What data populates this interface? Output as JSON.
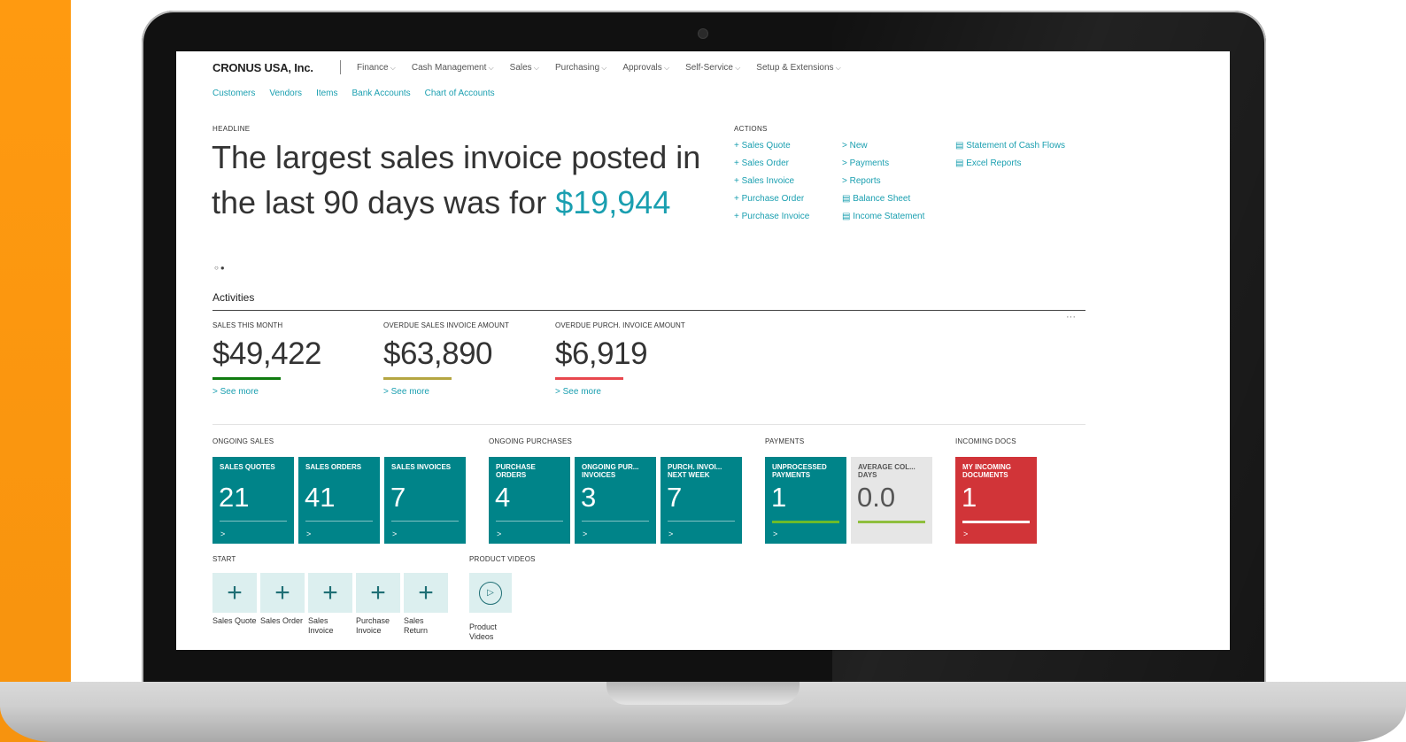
{
  "nav": {
    "company": "CRONUS USA, Inc.",
    "menus": [
      "Finance",
      "Cash Management",
      "Sales",
      "Purchasing",
      "Approvals",
      "Self-Service",
      "Setup & Extensions"
    ],
    "quick_links": [
      "Customers",
      "Vendors",
      "Items",
      "Bank Accounts",
      "Chart of Accounts"
    ]
  },
  "headline": {
    "label": "HEADLINE",
    "text": "The largest sales invoice posted in the last 90 days was for ",
    "amount": "$19,944",
    "dots": "○●"
  },
  "actions": {
    "label": "ACTIONS",
    "col1": [
      "+ Sales Quote",
      "+ Sales Order",
      "+ Sales Invoice",
      "+ Purchase Order",
      "+ Purchase Invoice"
    ],
    "col2": [
      "> New",
      "> Payments",
      "> Reports",
      "▤ Balance Sheet",
      "▤ Income Statement"
    ],
    "col3": [
      "▤ Statement of Cash Flows",
      "▤ Excel Reports"
    ]
  },
  "activities": {
    "title": "Activities",
    "ellipsis": "···",
    "kpis": [
      {
        "label": "SALES THIS MONTH",
        "value": "$49,422",
        "more": "> See more",
        "color": "#107c10"
      },
      {
        "label": "OVERDUE SALES INVOICE AMOUNT",
        "value": "$63,890",
        "more": "> See more",
        "color": "#b5a642"
      },
      {
        "label": "OVERDUE PURCH. INVOICE AMOUNT",
        "value": "$6,919",
        "more": "> See more",
        "color": "#e8474e"
      }
    ]
  },
  "groups": {
    "ongoing_sales": "ONGOING SALES",
    "ongoing_purchases": "ONGOING PURCHASES",
    "payments": "PAYMENTS",
    "incoming_docs": "INCOMING DOCS"
  },
  "tiles": [
    {
      "label": "SALES QUOTES",
      "value": "21",
      "chev": ">"
    },
    {
      "label": "SALES ORDERS",
      "value": "41",
      "chev": ">"
    },
    {
      "label": "SALES INVOICES",
      "value": "7",
      "chev": ">"
    },
    {
      "label": "PURCHASE ORDERS",
      "value": "4",
      "chev": ">"
    },
    {
      "label": "ONGOING PUR... INVOICES",
      "value": "3",
      "chev": ">"
    },
    {
      "label": "PURCH. INVOI... NEXT WEEK",
      "value": "7",
      "chev": ">"
    },
    {
      "label": "UNPROCESSED PAYMENTS",
      "value": "1",
      "chev": ">"
    },
    {
      "label": "AVERAGE COL... DAYS",
      "value": "0.0",
      "chev": ""
    },
    {
      "label": "MY INCOMING DOCUMENTS",
      "value": "1",
      "chev": ">"
    }
  ],
  "start": {
    "label": "START",
    "plus": "+",
    "items": [
      "Sales Quote",
      "Sales Order",
      "Sales Invoice",
      "Purchase Invoice",
      "Sales Return"
    ]
  },
  "product_videos": {
    "label": "PRODUCT VIDEOS",
    "caption": "Product Videos",
    "play": "▷"
  }
}
